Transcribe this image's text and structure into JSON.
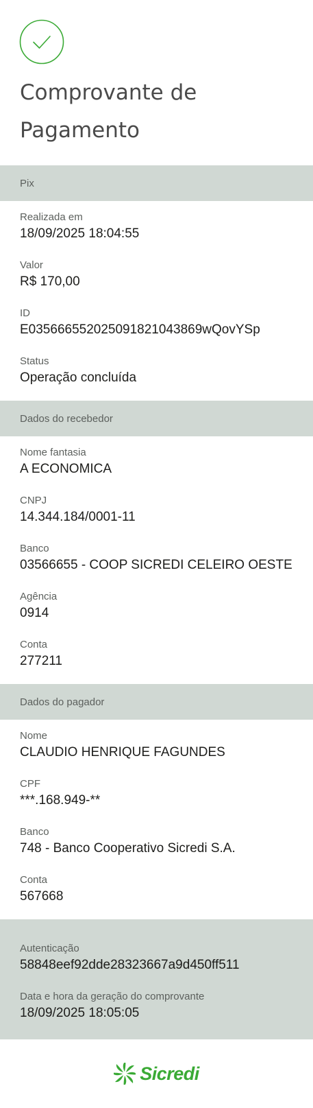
{
  "header": {
    "title_line1": "Comprovante de",
    "title_line2": "Pagamento"
  },
  "sections": {
    "pix": {
      "title": "Pix",
      "fields": [
        {
          "label": "Realizada em",
          "value": "18/09/2025 18:04:55"
        },
        {
          "label": "Valor",
          "value": "R$ 170,00"
        },
        {
          "label": "ID",
          "value": "E03566655202509182104386 9wQovYSp"
        },
        {
          "label": "Status",
          "value": "Operação concluída"
        }
      ]
    },
    "recebedor": {
      "title": "Dados do recebedor",
      "fields": [
        {
          "label": "Nome fantasia",
          "value": "A ECONOMICA"
        },
        {
          "label": "CNPJ",
          "value": "14.344.184/0001-11"
        },
        {
          "label": "Banco",
          "value": "03566655 - COOP SICREDI CELEIRO OESTE"
        },
        {
          "label": "Agência",
          "value": "0914"
        },
        {
          "label": "Conta",
          "value": "277211"
        }
      ]
    },
    "pagador": {
      "title": "Dados do pagador",
      "fields": [
        {
          "label": "Nome",
          "value": "CLAUDIO HENRIQUE FAGUNDES"
        },
        {
          "label": "CPF",
          "value": "***.168.949-**"
        },
        {
          "label": "Banco",
          "value": "748 - Banco Cooperativo Sicredi S.A."
        },
        {
          "label": "Conta",
          "value": "567668"
        }
      ]
    },
    "autenticacao": {
      "fields": [
        {
          "label": "Autenticação",
          "value": "58848eef92dde28323667a9d450ff511"
        },
        {
          "label": "Data e hora da geração do comprovante",
          "value": "18/09/2025 18:05:05"
        }
      ]
    }
  },
  "footer": {
    "brand_name": "Sicredi",
    "logo_icon": "sicredi-logo-icon"
  },
  "colors": {
    "accent_green": "#3aaa35",
    "section_bg": "#d0d8d3",
    "label_gray": "#5c605d",
    "value_dark": "#1d1d1b"
  }
}
